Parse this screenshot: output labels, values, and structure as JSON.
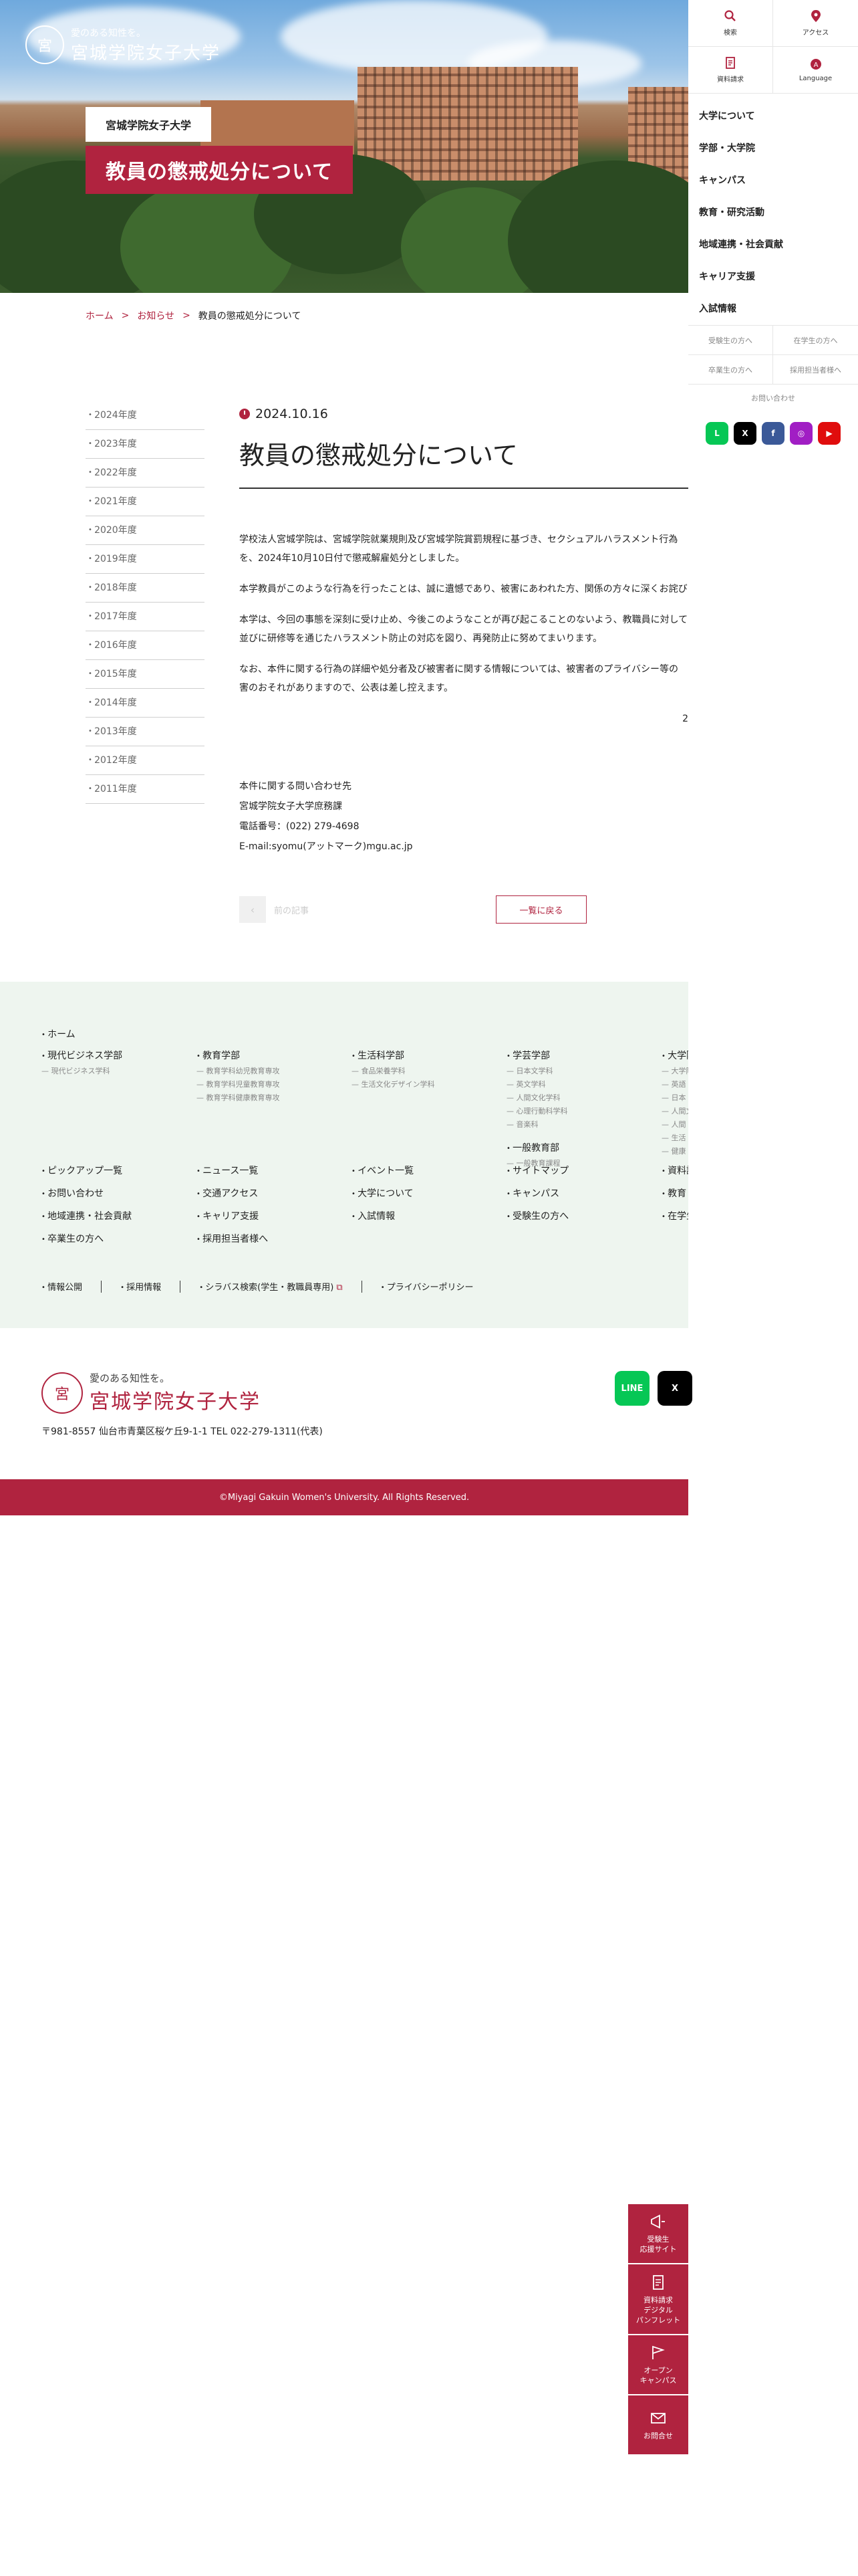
{
  "hero": {
    "logo_tagline": "愛のある知性を。",
    "logo_name": "宮城学院女子大学",
    "logo_seal": "宮",
    "label": "宮城学院女子大学",
    "title": "教員の懲戒処分について"
  },
  "sidenav": {
    "quick": [
      {
        "label": "検索",
        "icon": "search-icon"
      },
      {
        "label": "アクセス",
        "icon": "map-pin-icon"
      },
      {
        "label": "資料請求",
        "icon": "document-icon"
      },
      {
        "label": "Language",
        "icon": "language-icon"
      }
    ],
    "items": [
      "大学について",
      "学部・大学院",
      "キャンパス",
      "教育・研究活動",
      "地域連携・社会貢献",
      "キャリア支援",
      "入試情報"
    ],
    "sub": [
      "受験生の方へ",
      "在学生の方へ",
      "卒業生の方へ",
      "採用担当者様へ"
    ],
    "inquiry": "お問い合わせ",
    "sns": [
      {
        "name": "LINE",
        "short": "L",
        "color": "#06c755"
      },
      {
        "name": "X",
        "short": "X",
        "color": "#000000"
      },
      {
        "name": "Facebook",
        "short": "f",
        "color": "#3b5998"
      },
      {
        "name": "Instagram",
        "short": "◎",
        "color": "#a11ec4"
      },
      {
        "name": "YouTube",
        "short": "▶",
        "color": "#e00d0d"
      }
    ]
  },
  "breadcrumb": {
    "home": "ホーム",
    "news": "お知らせ",
    "current": "教員の懲戒処分について",
    "sep": ">"
  },
  "years": [
    "2024年度",
    "2023年度",
    "2022年度",
    "2021年度",
    "2020年度",
    "2019年度",
    "2018年度",
    "2017年度",
    "2016年度",
    "2015年度",
    "2014年度",
    "2013年度",
    "2012年度",
    "2011年度"
  ],
  "article": {
    "date": "2024.10.16",
    "title": "教員の懲戒処分について",
    "p1a": "学校法人宮城学院は、宮城学院就業規則及び宮城学院賞罰規程に基づき、セクシュアルハラスメント行為",
    "p1b": "を、2024年10月10日付で懲戒解雇処分としました。",
    "p2a": "本学教員がこのような行為を行ったことは、誠に遺憾であり、被害にあわれた方、関係の方々に深くお詫び",
    "p3a": "本学は、今回の事態を深刻に受け止め、今後このようなことが再び起こることのないよう、教職員に対して",
    "p3b": "並びに研修等を通じたハラスメント防止の対応を図り、再発防止に努めてまいります。",
    "p4a": "なお、本件に関する行為の詳細や処分者及び被害者に関する情報については、被害者のプライバシー等の",
    "p4b": "害のおそれがありますので、公表は差し控えます。",
    "right": "2",
    "contact1": "本件に関する問い合わせ先",
    "contact2": "宮城学院女子大学庶務課",
    "contact3": "電話番号：(022) 279-4698",
    "contact4": "E-mail:syomu(アットマーク)mgu.ac.jp",
    "prev": "前の記事",
    "back": "一覧に戻る"
  },
  "footnav": {
    "home": "ホーム",
    "cols": [
      {
        "h": "現代ビジネス学部",
        "subs": [
          "現代ビジネス学科"
        ],
        "h2": "",
        "subs2": []
      },
      {
        "h": "教育学部",
        "subs": [
          "教育学科幼児教育専攻",
          "教育学科児童教育専攻",
          "教育学科健康教育専攻"
        ],
        "h2": "",
        "subs2": []
      },
      {
        "h": "生活科学部",
        "subs": [
          "食品栄養学科",
          "生活文化デザイン学科"
        ],
        "h2": "",
        "subs2": []
      },
      {
        "h": "学芸学部",
        "subs": [
          "日本文学科",
          "英文学科",
          "人間文化学科",
          "心理行動科学科",
          "音楽科"
        ],
        "h2": "一般教育部",
        "subs2": [
          "一般教育課程"
        ]
      },
      {
        "h": "大学院",
        "subs": [
          "大学院",
          "英語",
          "日本",
          "人間文",
          "人間",
          "生活",
          "健康"
        ],
        "h2": "",
        "subs2": []
      }
    ],
    "links": [
      "ピックアップ一覧",
      "ニュース一覧",
      "イベント一覧",
      "サイトマップ",
      "資料請求",
      "お問い合わせ",
      "交通アクセス",
      "大学について",
      "キャンパス",
      "教育・研究",
      "地域連携・社会貢献",
      "キャリア支援",
      "入試情報",
      "受験生の方へ",
      "在学生の方へ",
      "卒業生の方へ",
      "採用担当者様へ"
    ],
    "bottom": [
      "情報公開",
      "採用情報",
      "シラバス検索(学生・教職員専用)",
      "プライバシーポリシー"
    ]
  },
  "finfo": {
    "tagline": "愛のある知性を。",
    "name": "宮城学院女子大学",
    "seal": "宮",
    "address": "〒981-8557 仙台市青葉区桜ケ丘9-1-1 TEL 022-279-1311(代表)",
    "sns": [
      {
        "name": "LINE",
        "short": "LINE",
        "color": "#06c755"
      },
      {
        "name": "X",
        "short": "X",
        "color": "#000000"
      }
    ]
  },
  "copyright": "©Miyagi Gakuin Women's University. All Rights Reserved.",
  "floats": [
    {
      "label1": "受験生",
      "label2": "応援サイト",
      "label3": "",
      "icon": "megaphone-icon"
    },
    {
      "label1": "資料請求",
      "label2": "デジタル",
      "label3": "パンフレット",
      "icon": "document-icon"
    },
    {
      "label1": "オープン",
      "label2": "キャンパス",
      "label3": "",
      "icon": "flag-icon"
    },
    {
      "label1": "お問合せ",
      "label2": "",
      "label3": "",
      "icon": "mail-icon"
    }
  ],
  "colors": {
    "accent": "#b0233f",
    "footer_bg": "#eef5ef"
  }
}
